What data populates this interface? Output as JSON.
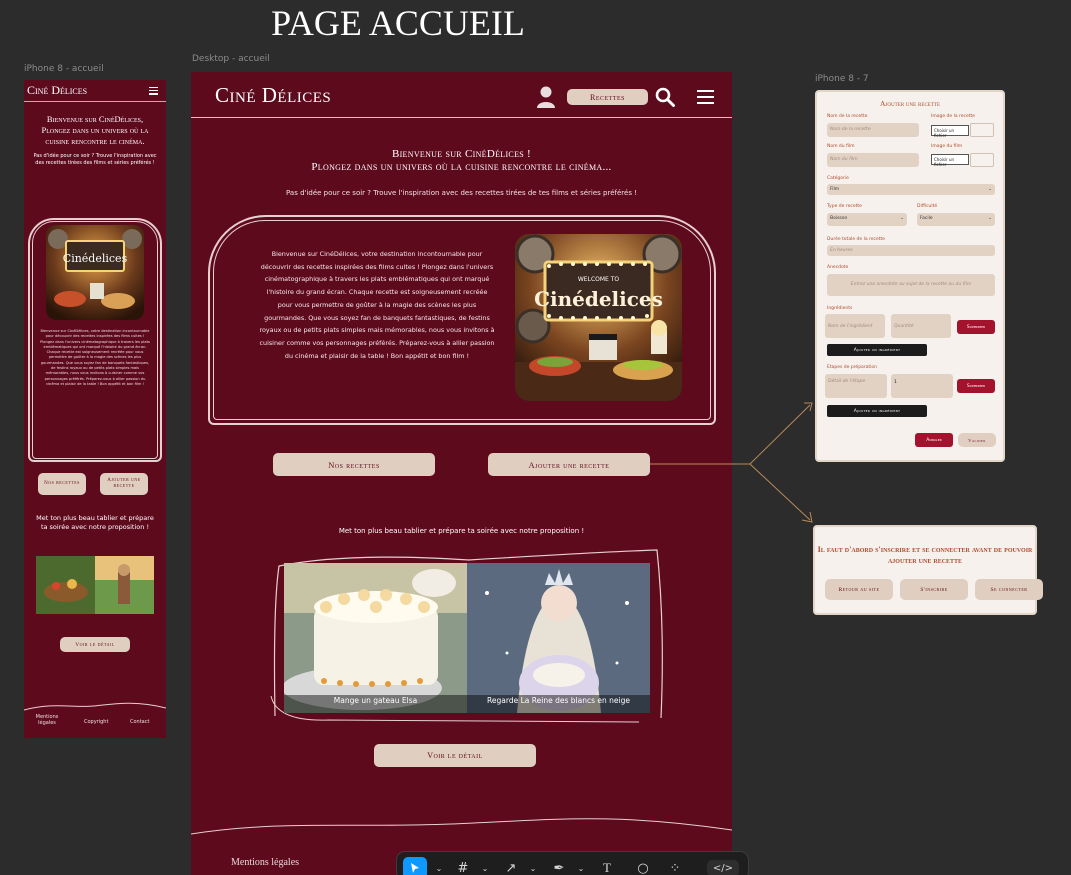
{
  "page_title": "PAGE ACCUEIL",
  "frames": {
    "iphone_label": "iPhone 8 - accueil",
    "desktop_label": "Desktop - accueil",
    "form_label": "iPhone 8 - 7"
  },
  "brand": {
    "logo": "Ciné Délices",
    "wine": "#5e0a1d",
    "pill": "#e0cfc0",
    "accent": "#b04a2e"
  },
  "header": {
    "recipes_button": "Recettes",
    "user_icon": "user-icon",
    "search_icon": "search-icon",
    "menu_icon": "hamburger-icon"
  },
  "mobile": {
    "welcome": "Bienvenue sur CinéDélices,  Plongez dans un univers où la cuisine rencontre le cinéma.",
    "subtitle": "Pas d'idée pour ce soir ? Trouve l'inspiration avec des recettes tirées des films et séries préférés !",
    "poster_title": "Cinédelices",
    "intro": "Bienvenue sur CinéDélices, votre destination incontournable pour découvrir des recettes inspirées des films cultes ! Plongez dans l'univers cinématographique à travers les plats emblématiques qui ont marqué l'histoire du grand écran. Chaque recette est soigneusement recréée pour vous permettre de goûter à la magie des scènes les plus gourmandes. Que vous soyez fan de banquets fantastiques, de festins royaux ou de petits plats simples mais mémorables, nous vous invitons à cuisiner comme vos personnages préférés. Préparez-vous à allier passion du cinéma et plaisir de la table ! Bon appétit et bon film !",
    "btn_recipes": "Nos recettes",
    "btn_add": "Ajouter une recette",
    "proposal": "Met ton plus beau tablier et prépare ta soirée avec notre proposition !",
    "btn_detail": "Voir le détail",
    "footer": [
      "Mentions légales",
      "Copyright",
      "Contact"
    ]
  },
  "desktop": {
    "welcome_line1": "Bienvenue sur CinéDélices !",
    "welcome_line2": "Plongez dans un univers où la cuisine rencontre le cinéma...",
    "subtitle": "Pas d'idée pour ce soir ? Trouve l'inspiration avec des recettes tirées de tes films et séries préférés !",
    "intro": "Bienvenue sur CinéDélices, votre destination incontournable pour découvrir des recettes inspirées des films cultes ! Plongez dans l'univers cinématographique à travers les plats emblématiques qui ont marqué l'histoire du grand écran. Chaque recette est soigneusement recréée pour vous permettre de goûter à la magie des scènes les plus gourmandes. Que vous soyez fan de banquets fantastiques, de festins royaux ou de petits plats simples mais mémorables, nous vous invitons à cuisiner comme vos personnages préférés. Préparez-vous à allier passion du cinéma et plaisir de la table ! Bon appétit et bon film !",
    "poster_small": "WELCOME TO",
    "poster_title": "Cinédelices",
    "btn_recipes": "Nos recettes",
    "btn_add": "Ajouter une recette",
    "proposal": "Met ton plus beau tablier et prépare ta soirée avec notre proposition !",
    "gallery": [
      {
        "caption": "Mange un gateau Elsa"
      },
      {
        "caption": "Regarde La Reine des blancs en neige"
      }
    ],
    "btn_detail": "Voir le détail",
    "footer_mentions": "Mentions légales"
  },
  "form": {
    "title": "Ajouter une recette",
    "recipe_name_label": "Nom de la recette",
    "recipe_name_ph": "Nom de la recette",
    "recipe_image_label": "Image de la recette",
    "file_btn": "Choisir un fichier",
    "film_name_label": "Nom du film",
    "film_name_ph": "Nom du film",
    "film_image_label": "Image du film",
    "category_label": "Catégorie",
    "category_value": "Film",
    "type_label": "Type de recette",
    "type_value": "Boisson",
    "difficulty_label": "Difficulté",
    "difficulty_value": "Facile",
    "duration_label": "Durée totale de la recette",
    "duration_ph": "En heures",
    "anecdote_label": "Anecdote",
    "anecdote_ph": "Entrez une anecdote au sujet de la recette ou du film",
    "ingredients_label": "Ingrédients",
    "ingredient_name_ph": "Nom de l'ingrédient",
    "quantity_ph": "Quantité",
    "delete_btn": "Supprimer",
    "add_ingredient_btn": "Ajouter un ingrédient",
    "steps_label": "Etapes de préparation",
    "step_desc_ph": "Détail de l'étape",
    "step_number": "1",
    "add_step_btn": "Ajouter un ingrédient",
    "cancel_btn": "Annuler",
    "validate_btn": "Valider"
  },
  "modal": {
    "message": "Il faut d'abord s'inscrire et se connecter avant de pouvoir ajouter une recette",
    "back_btn": "Retour au site",
    "signup_btn": "S'inscrire",
    "login_btn": "Se connecter"
  },
  "toolbar": {
    "tools": [
      "move-tool-icon",
      "frame-tool-icon",
      "line-tool-icon",
      "pen-tool-icon",
      "text-tool-icon",
      "ellipse-tool-icon",
      "resources-icon",
      "dev-mode-icon"
    ],
    "active_color": "#0d99ff"
  }
}
